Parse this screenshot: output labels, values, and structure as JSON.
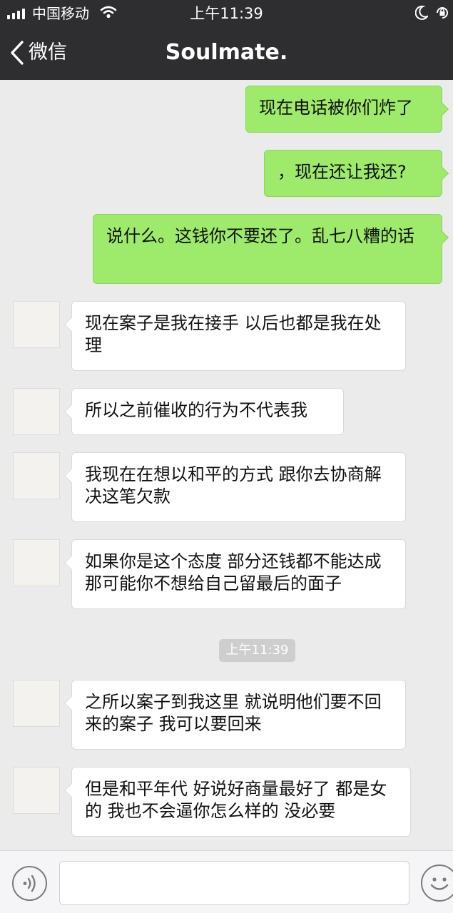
{
  "status_bar": {
    "carrier": "中国移动",
    "time": "上午11:39"
  },
  "nav": {
    "back_label": "微信",
    "title": "Soulmate."
  },
  "colors": {
    "header_bg": "#2e2e31",
    "chat_bg": "#ebebeb",
    "outgoing_bubble": "#9eea6a",
    "incoming_bubble": "#ffffff"
  },
  "messages": [
    {
      "direction": "outgoing",
      "text": "现在电话被你们炸了"
    },
    {
      "direction": "outgoing",
      "text": "，现在还让我还?"
    },
    {
      "direction": "outgoing",
      "text": "说什么。这钱你不要还了。乱七八糟的话"
    },
    {
      "direction": "incoming",
      "text": "现在案子是我在接手 以后也都是我在处理"
    },
    {
      "direction": "incoming",
      "text": "所以之前催收的行为不代表我"
    },
    {
      "direction": "incoming",
      "text": "我现在在想以和平的方式 跟你去协商解决这笔欠款"
    },
    {
      "direction": "incoming",
      "text": "如果你是这个态度 部分还钱都不能达成 那可能你不想给自己留最后的面子"
    },
    {
      "direction": "incoming",
      "text": "之所以案子到我这里 就说明他们要不回来的案子 我可以要回来"
    },
    {
      "direction": "incoming",
      "text": "但是和平年代 好说好商量最好了 都是女的 我也不会逼你怎么样的 没必要"
    }
  ],
  "timestamp_divider": "上午11:39",
  "input_bar": {
    "voice_icon": "voice-icon",
    "emoji_icon": "emoji-icon"
  }
}
